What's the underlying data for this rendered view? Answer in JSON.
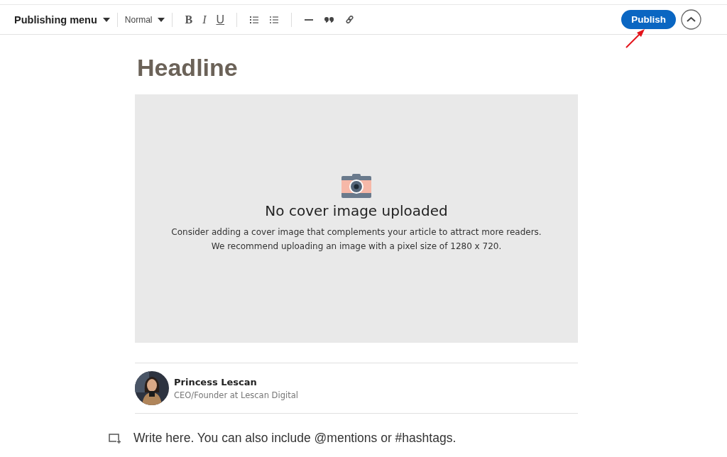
{
  "toolbar": {
    "publishing_menu": "Publishing menu",
    "style": "Normal",
    "format_buttons": [
      {
        "label": "B",
        "kind": "bold"
      },
      {
        "label": "I",
        "kind": "italic"
      },
      {
        "label": "U",
        "kind": "underline"
      }
    ],
    "publish_button": "Publish"
  },
  "editor": {
    "headline": {
      "placeholder": "Headline"
    },
    "cover": {
      "title": "No cover image uploaded",
      "lines": [
        "Consider adding a cover image that complements your article to attract more readers.",
        "We recommend uploading an image with a pixel size of 1280 x 720."
      ]
    },
    "author": {
      "name": "Princess Lescan",
      "role": "CEO/Founder at Lescan Digital"
    },
    "body": {
      "placeholder": "Write here. You can also include @mentions or #hashtags."
    }
  }
}
